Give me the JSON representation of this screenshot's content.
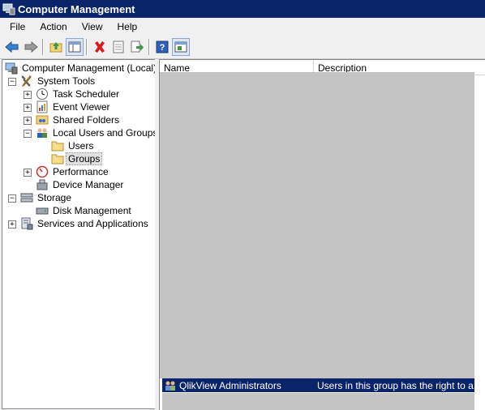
{
  "window": {
    "title": "Computer Management"
  },
  "menu": [
    "File",
    "Action",
    "View",
    "Help"
  ],
  "toolbar": {
    "buttons": [
      "back-icon",
      "forward-icon",
      "up-folder-icon",
      "show-hide-tree-icon",
      "delete-icon",
      "properties-icon",
      "export-list-icon",
      "help-icon",
      "show-hide-action-pane-icon"
    ]
  },
  "tree": {
    "root": "Computer Management (Local)",
    "system_tools": "System Tools",
    "task_scheduler": "Task Scheduler",
    "event_viewer": "Event Viewer",
    "shared_folders": "Shared Folders",
    "local_users_groups": "Local Users and Groups",
    "users": "Users",
    "groups": "Groups",
    "performance": "Performance",
    "device_manager": "Device Manager",
    "storage": "Storage",
    "disk_management": "Disk Management",
    "services_apps": "Services and Applications",
    "selected": "Groups"
  },
  "list": {
    "columns": [
      "Name",
      "Description"
    ],
    "rows": [
      {
        "name": "QlikView Administrators",
        "description": "Users in this group has the right to a..."
      }
    ],
    "selected_color": "#0a246a"
  }
}
